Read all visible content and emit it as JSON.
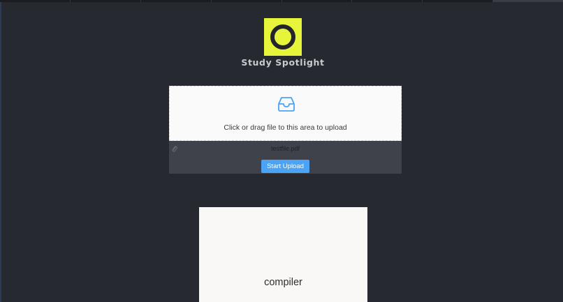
{
  "brand": {
    "name": "Study Spotlight",
    "logo_color": "#e6f53a"
  },
  "upload": {
    "dropzone_text": "Click or drag file to this area to upload",
    "dropzone_icon": "inbox-icon",
    "file_icon": "paperclip-icon",
    "file_name": "testfile.pdf",
    "start_button_label": "Start Upload",
    "button_color": "#4aa3f5"
  },
  "card": {
    "word": "compiler"
  }
}
